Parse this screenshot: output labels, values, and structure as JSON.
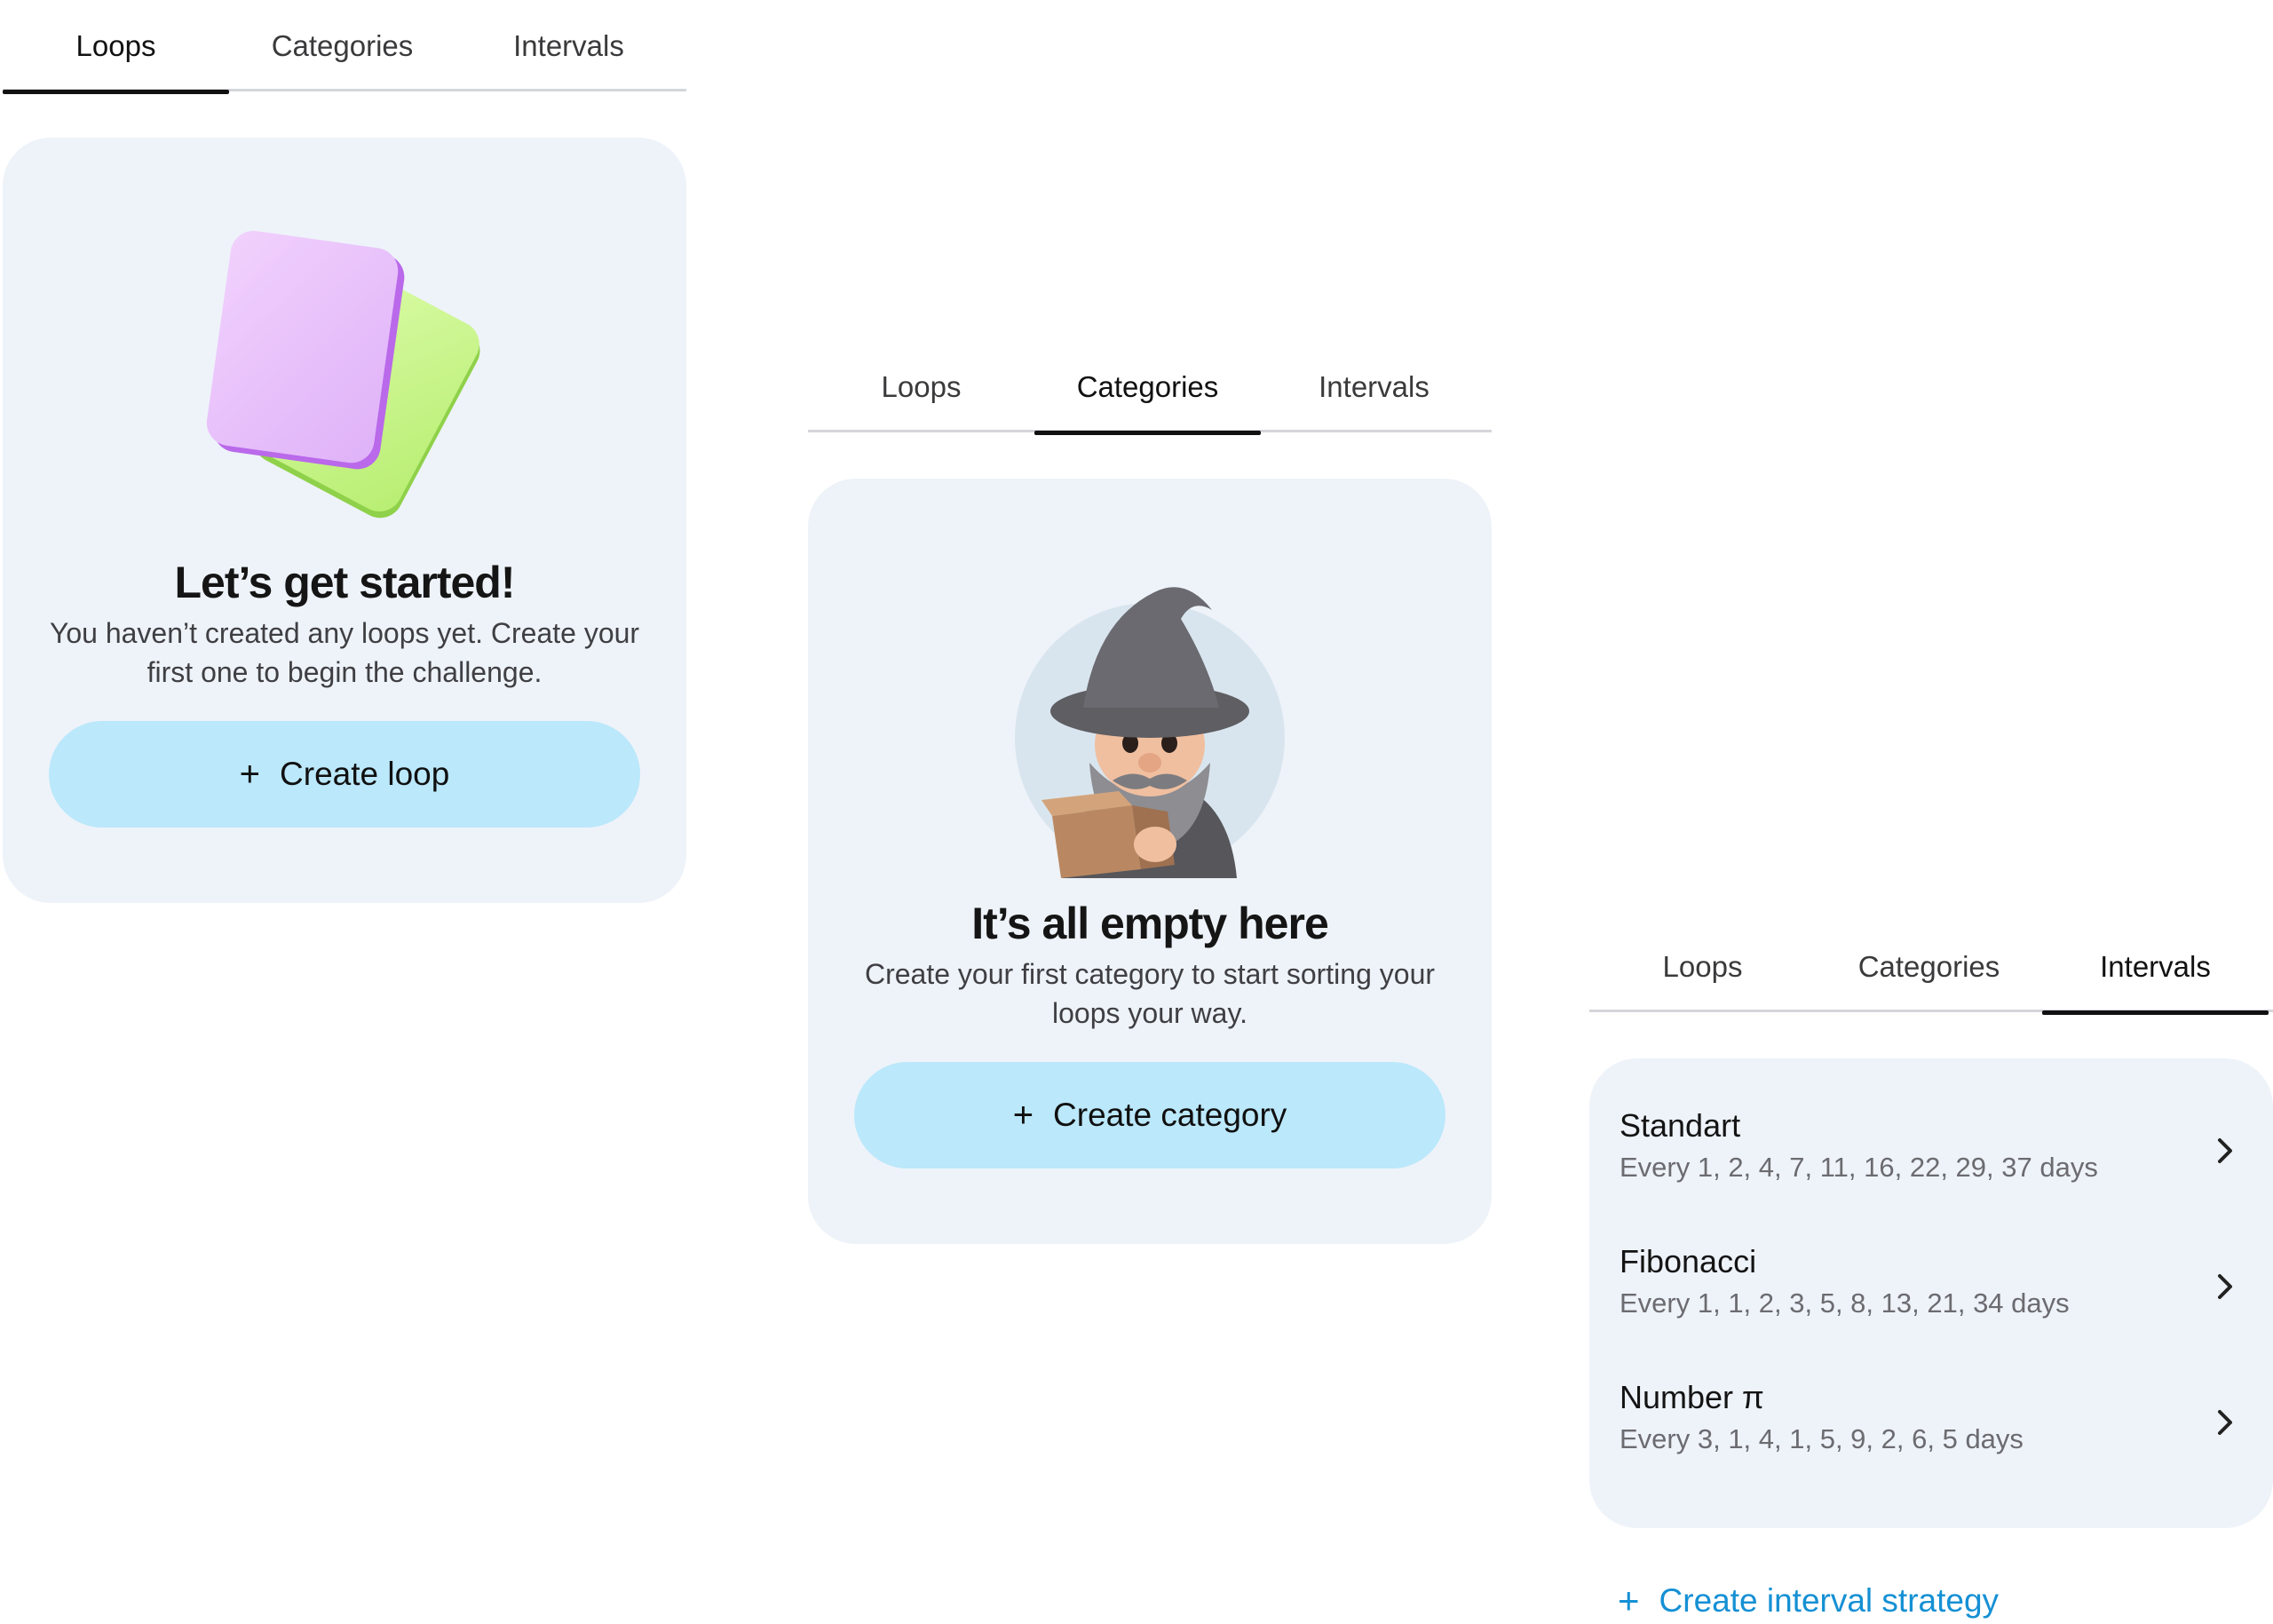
{
  "tabs": [
    {
      "label": "Loops"
    },
    {
      "label": "Categories"
    },
    {
      "label": "Intervals"
    }
  ],
  "loops_panel": {
    "active_tab": "Loops",
    "title": "Let’s get started!",
    "message": "You haven’t created any loops yet. Create your first one to begin the challenge.",
    "button_label": "Create loop",
    "illustration": "stacked-cards-illustration",
    "colors": {
      "card_front": "#e9c2fb",
      "card_back": "#d0f89a"
    }
  },
  "categories_panel": {
    "active_tab": "Categories",
    "title": "It’s all empty here",
    "message": "Create your first category to start sorting your loops your way.",
    "button_label": "Create category",
    "illustration": "sad-wizard-illustration"
  },
  "intervals_panel": {
    "active_tab": "Intervals",
    "items": [
      {
        "name": "Standart",
        "description": "Every 1, 2, 4, 7, 11, 16, 22, 29, 37 days"
      },
      {
        "name": "Fibonacci",
        "description": "Every 1, 1, 2, 3, 5, 8, 13, 21, 34 days"
      },
      {
        "name": "Number π",
        "description": "Every 3, 1, 4, 1, 5, 9, 2, 6, 5 days"
      }
    ],
    "create_label": "Create interval strategy"
  },
  "colors": {
    "card_bg": "#eef3f9",
    "button_bg": "#bbe8fb",
    "link": "#1590d4",
    "active_tab_indicator": "#111111"
  }
}
